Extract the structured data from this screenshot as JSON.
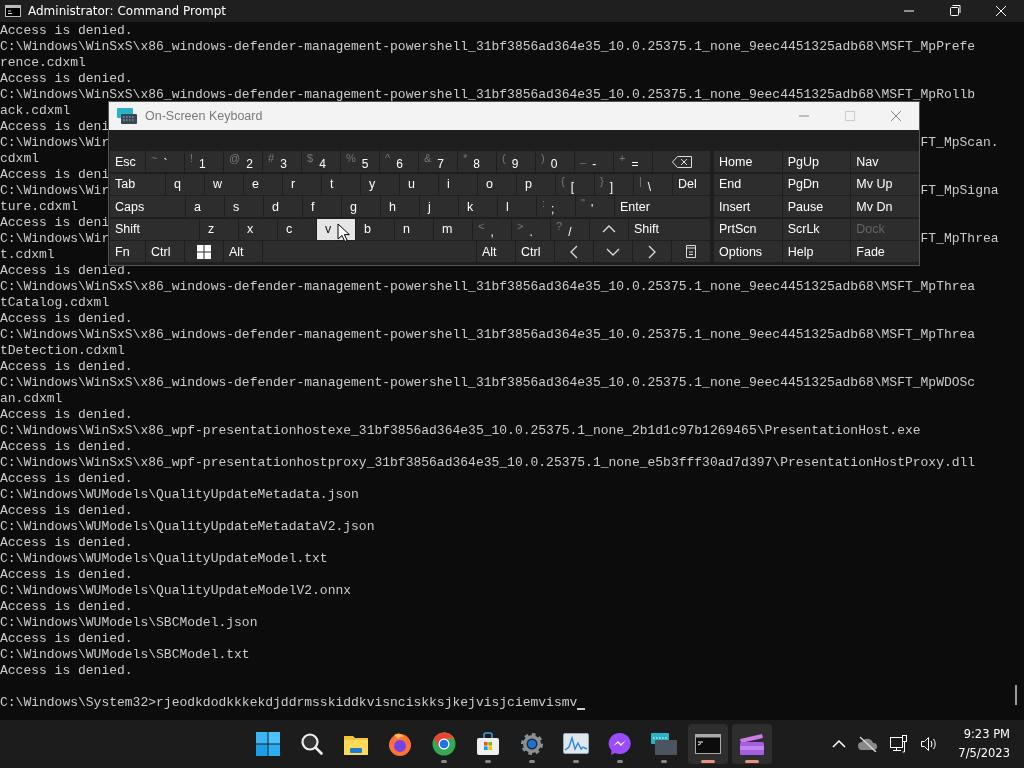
{
  "window": {
    "title": "Administrator: Command Prompt"
  },
  "console": {
    "lines": [
      {
        "kind": "output",
        "text": "Access is denied."
      },
      {
        "kind": "output",
        "text": "C:\\Windows\\WinSxS\\x86_windows-defender-management-powershell_31bf3856ad364e35_10.0.25375.1_none_9eec4451325adb68\\MSFT_MpPrefe"
      },
      {
        "kind": "output",
        "text": "rence.cdxml"
      },
      {
        "kind": "output",
        "text": "Access is denied."
      },
      {
        "kind": "output",
        "text": "C:\\Windows\\WinSxS\\x86_windows-defender-management-powershell_31bf3856ad364e35_10.0.25375.1_none_9eec4451325adb68\\MSFT_MpRollb"
      },
      {
        "kind": "output",
        "text": "ack.cdxml"
      },
      {
        "kind": "output",
        "text": "Access is deni"
      },
      {
        "kind": "covered",
        "text": "C:\\Windows\\Wir",
        "right": "FT_MpScan."
      },
      {
        "kind": "output",
        "text": "cdxml"
      },
      {
        "kind": "output",
        "text": "Access is deni"
      },
      {
        "kind": "covered",
        "text": "C:\\Windows\\Wir",
        "right": "FT_MpSigna"
      },
      {
        "kind": "output",
        "text": "ture.cdxml"
      },
      {
        "kind": "output",
        "text": "Access is deni"
      },
      {
        "kind": "covered",
        "text": "C:\\Windows\\Wir",
        "right": "FT_MpThrea"
      },
      {
        "kind": "output",
        "text": "t.cdxml"
      },
      {
        "kind": "output",
        "text": "Access is denied."
      },
      {
        "kind": "output",
        "text": "C:\\Windows\\WinSxS\\x86_windows-defender-management-powershell_31bf3856ad364e35_10.0.25375.1_none_9eec4451325adb68\\MSFT_MpThrea"
      },
      {
        "kind": "output",
        "text": "tCatalog.cdxml"
      },
      {
        "kind": "output",
        "text": "Access is denied."
      },
      {
        "kind": "output",
        "text": "C:\\Windows\\WinSxS\\x86_windows-defender-management-powershell_31bf3856ad364e35_10.0.25375.1_none_9eec4451325adb68\\MSFT_MpThrea"
      },
      {
        "kind": "output",
        "text": "tDetection.cdxml"
      },
      {
        "kind": "output",
        "text": "Access is denied."
      },
      {
        "kind": "output",
        "text": "C:\\Windows\\WinSxS\\x86_windows-defender-management-powershell_31bf3856ad364e35_10.0.25375.1_none_9eec4451325adb68\\MSFT_MpWDOSc"
      },
      {
        "kind": "output",
        "text": "an.cdxml"
      },
      {
        "kind": "output",
        "text": "Access is denied."
      },
      {
        "kind": "output",
        "text": "C:\\Windows\\WinSxS\\x86_wpf-presentationhostexe_31bf3856ad364e35_10.0.25375.1_none_2b1d1c97b1269465\\PresentationHost.exe"
      },
      {
        "kind": "output",
        "text": "Access is denied."
      },
      {
        "kind": "output",
        "text": "C:\\Windows\\WinSxS\\x86_wpf-presentationhostproxy_31bf3856ad364e35_10.0.25375.1_none_e5b3fff30ad7d397\\PresentationHostProxy.dll"
      },
      {
        "kind": "output",
        "text": "Access is denied."
      },
      {
        "kind": "output",
        "text": "C:\\Windows\\WUModels\\QualityUpdateMetadata.json"
      },
      {
        "kind": "output",
        "text": "Access is denied."
      },
      {
        "kind": "output",
        "text": "C:\\Windows\\WUModels\\QualityUpdateMetadataV2.json"
      },
      {
        "kind": "output",
        "text": "Access is denied."
      },
      {
        "kind": "output",
        "text": "C:\\Windows\\WUModels\\QualityUpdateModel.txt"
      },
      {
        "kind": "output",
        "text": "Access is denied."
      },
      {
        "kind": "output",
        "text": "C:\\Windows\\WUModels\\QualityUpdateModelV2.onnx"
      },
      {
        "kind": "output",
        "text": "Access is denied."
      },
      {
        "kind": "output",
        "text": "C:\\Windows\\WUModels\\SBCModel.json"
      },
      {
        "kind": "output",
        "text": "Access is denied."
      },
      {
        "kind": "output",
        "text": "C:\\Windows\\WUModels\\SBCModel.txt"
      },
      {
        "kind": "output",
        "text": "Access is denied."
      },
      {
        "kind": "blank"
      },
      {
        "kind": "prompt",
        "text": "C:\\Windows\\System32>rjeodkdodkkkekdjddrmsskiddkvisnciskksjkejvisjciemvismv"
      }
    ]
  },
  "keyboard": {
    "title": "On-Screen Keyboard",
    "rows": [
      {
        "keys": [
          {
            "kind": "label",
            "main": "Esc",
            "highlighted": false
          },
          {
            "kind": "char",
            "shift": "~",
            "main": "`",
            "highlighted": false
          },
          {
            "kind": "char",
            "shift": "!",
            "main": "1",
            "highlighted": false
          },
          {
            "kind": "char",
            "shift": "@",
            "main": "2",
            "highlighted": false
          },
          {
            "kind": "char",
            "shift": "#",
            "main": "3",
            "highlighted": false
          },
          {
            "kind": "char",
            "shift": "$",
            "main": "4",
            "highlighted": false
          },
          {
            "kind": "char",
            "shift": "%",
            "main": "5",
            "highlighted": false
          },
          {
            "kind": "char",
            "shift": "^",
            "main": "6",
            "highlighted": false
          },
          {
            "kind": "char",
            "shift": "&",
            "main": "7",
            "highlighted": false
          },
          {
            "kind": "char",
            "shift": "*",
            "main": "8",
            "highlighted": false
          },
          {
            "kind": "char",
            "shift": "(",
            "main": "9",
            "highlighted": false
          },
          {
            "kind": "char",
            "shift": ")",
            "main": "0",
            "highlighted": false
          },
          {
            "kind": "char",
            "shift": "_",
            "main": "-",
            "highlighted": false
          },
          {
            "kind": "char",
            "shift": "+",
            "main": "=",
            "highlighted": false
          },
          {
            "kind": "backspace",
            "highlighted": false
          }
        ]
      },
      {
        "keys": [
          {
            "kind": "label",
            "main": "Tab",
            "highlighted": false
          },
          {
            "kind": "letter",
            "main": "q",
            "highlighted": false
          },
          {
            "kind": "letter",
            "main": "w",
            "highlighted": false
          },
          {
            "kind": "letter",
            "main": "e",
            "highlighted": false
          },
          {
            "kind": "letter",
            "main": "r",
            "highlighted": false
          },
          {
            "kind": "letter",
            "main": "t",
            "highlighted": false
          },
          {
            "kind": "letter",
            "main": "y",
            "highlighted": false
          },
          {
            "kind": "letter",
            "main": "u",
            "highlighted": false
          },
          {
            "kind": "letter",
            "main": "i",
            "highlighted": false
          },
          {
            "kind": "letter",
            "main": "o",
            "highlighted": false
          },
          {
            "kind": "letter",
            "main": "p",
            "highlighted": false
          },
          {
            "kind": "char",
            "shift": "{",
            "main": "[",
            "highlighted": false
          },
          {
            "kind": "char",
            "shift": "}",
            "main": "]",
            "highlighted": false
          },
          {
            "kind": "char",
            "shift": "|",
            "main": "\\",
            "highlighted": false
          },
          {
            "kind": "label",
            "main": "Del",
            "highlighted": false
          }
        ]
      },
      {
        "keys": [
          {
            "kind": "label",
            "main": "Caps",
            "highlighted": false
          },
          {
            "kind": "letter",
            "main": "a",
            "highlighted": false
          },
          {
            "kind": "letter",
            "main": "s",
            "highlighted": false
          },
          {
            "kind": "letter",
            "main": "d",
            "highlighted": false
          },
          {
            "kind": "letter",
            "main": "f",
            "highlighted": false
          },
          {
            "kind": "letter",
            "main": "g",
            "highlighted": false
          },
          {
            "kind": "letter",
            "main": "h",
            "highlighted": false
          },
          {
            "kind": "letter",
            "main": "j",
            "highlighted": false
          },
          {
            "kind": "letter",
            "main": "k",
            "highlighted": false
          },
          {
            "kind": "letter",
            "main": "l",
            "highlighted": false
          },
          {
            "kind": "char",
            "shift": ":",
            "main": ";",
            "highlighted": false
          },
          {
            "kind": "char",
            "shift": "\"",
            "main": "'",
            "highlighted": false
          },
          {
            "kind": "label",
            "main": "Enter",
            "highlighted": false
          }
        ]
      },
      {
        "keys": [
          {
            "kind": "label",
            "main": "Shift",
            "highlighted": false
          },
          {
            "kind": "letter",
            "main": "z",
            "highlighted": false
          },
          {
            "kind": "letter",
            "main": "x",
            "highlighted": false
          },
          {
            "kind": "letter",
            "main": "c",
            "highlighted": false
          },
          {
            "kind": "letter",
            "main": "v",
            "highlighted": true
          },
          {
            "kind": "letter",
            "main": "b",
            "highlighted": false
          },
          {
            "kind": "letter",
            "main": "n",
            "highlighted": false
          },
          {
            "kind": "letter",
            "main": "m",
            "highlighted": false
          },
          {
            "kind": "char",
            "shift": "<",
            "main": ",",
            "highlighted": false
          },
          {
            "kind": "char",
            "shift": ">",
            "main": ".",
            "highlighted": false
          },
          {
            "kind": "char",
            "shift": "?",
            "main": "/",
            "highlighted": false
          },
          {
            "kind": "up",
            "highlighted": false
          },
          {
            "kind": "label",
            "main": "Shift",
            "highlighted": false
          }
        ]
      },
      {
        "keys": [
          {
            "kind": "label",
            "main": "Fn",
            "highlighted": false
          },
          {
            "kind": "label",
            "main": "Ctrl",
            "highlighted": false
          },
          {
            "kind": "windows",
            "highlighted": false
          },
          {
            "kind": "label",
            "main": "Alt",
            "highlighted": false
          },
          {
            "kind": "space",
            "highlighted": false
          },
          {
            "kind": "label",
            "main": "Alt",
            "highlighted": false
          },
          {
            "kind": "label",
            "main": "Ctrl",
            "highlighted": false
          },
          {
            "kind": "left",
            "highlighted": false
          },
          {
            "kind": "down",
            "highlighted": false
          },
          {
            "kind": "right",
            "highlighted": false
          },
          {
            "kind": "menu",
            "highlighted": false
          }
        ]
      }
    ],
    "nav_keys": [
      {
        "label": "Home",
        "disabled": false
      },
      {
        "label": "PgUp",
        "disabled": false
      },
      {
        "label": "Nav",
        "disabled": false
      },
      {
        "label": "End",
        "disabled": false
      },
      {
        "label": "PgDn",
        "disabled": false
      },
      {
        "label": "Mv Up",
        "disabled": false
      },
      {
        "label": "Insert",
        "disabled": false
      },
      {
        "label": "Pause",
        "disabled": false
      },
      {
        "label": "Mv Dn",
        "disabled": false
      },
      {
        "label": "PrtScn",
        "disabled": false
      },
      {
        "label": "ScrLk",
        "disabled": false
      },
      {
        "label": "Dock",
        "disabled": true
      },
      {
        "label": "Options",
        "disabled": false
      },
      {
        "label": "Help",
        "disabled": false
      },
      {
        "label": "Fade",
        "disabled": false
      }
    ]
  },
  "taskbar": {
    "apps": [
      {
        "kind": "start",
        "running": false,
        "active": false
      },
      {
        "kind": "search",
        "running": false,
        "active": false
      },
      {
        "kind": "folder",
        "running": false,
        "active": false
      },
      {
        "kind": "firefox",
        "running": false,
        "active": false
      },
      {
        "kind": "chrome",
        "running": true,
        "active": false
      },
      {
        "kind": "store",
        "running": true,
        "active": false
      },
      {
        "kind": "settings",
        "running": true,
        "active": false
      },
      {
        "kind": "monitor",
        "running": true,
        "active": false
      },
      {
        "kind": "messenger",
        "running": true,
        "active": false
      },
      {
        "kind": "keyboard",
        "running": true,
        "active": false
      },
      {
        "kind": "terminal",
        "running": true,
        "active": true
      },
      {
        "kind": "video",
        "running": true,
        "active": true
      }
    ],
    "time": "9:23 PM",
    "date": "7/5/2023"
  }
}
